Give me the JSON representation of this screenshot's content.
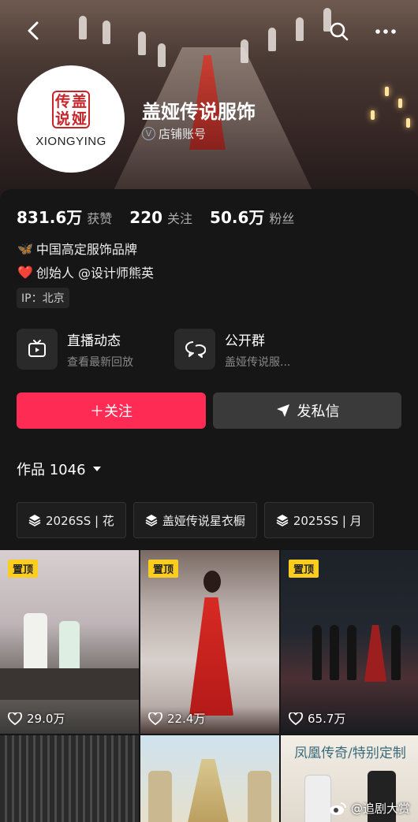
{
  "header": {
    "shop_name": "盖娅传说服饰",
    "shop_tag": "店铺账号",
    "logo_text": "XIONGYING",
    "logo_seal_chars": [
      "传",
      "盖",
      "说",
      "娅"
    ]
  },
  "stats": {
    "likes_value": "831.6万",
    "likes_label": "获赞",
    "following_value": "220",
    "following_label": "关注",
    "followers_value": "50.6万",
    "followers_label": "粉丝"
  },
  "bio": {
    "line1_emoji": "🦋",
    "line1": "中国高定服饰品牌",
    "line2_emoji": "❤️",
    "line2": "创始人 @设计师熊英",
    "ip": "IP：北京"
  },
  "features": [
    {
      "title": "直播动态",
      "subtitle": "查看最新回放",
      "icon": "tv-icon"
    },
    {
      "title": "公开群",
      "subtitle": "盖娅传说服...",
      "icon": "chat-icon"
    }
  ],
  "actions": {
    "follow": "＋关注",
    "message": "发私信"
  },
  "works": {
    "label": "作品 1046"
  },
  "collections": [
    "2026SS | 花",
    "盖娅传说星衣橱",
    "2025SS | 月"
  ],
  "videos": [
    {
      "pinned": "置顶",
      "likes": "29.0万"
    },
    {
      "pinned": "置顶",
      "likes": "22.4万"
    },
    {
      "pinned": "置顶",
      "likes": "65.7万"
    }
  ],
  "bottom_row": {
    "third_overlay": "凤凰传奇/特别定制"
  },
  "watermark": "@追剧大赏",
  "colors": {
    "follow": "#fe2c55",
    "pin": "#facd1e",
    "background": "#161616"
  }
}
